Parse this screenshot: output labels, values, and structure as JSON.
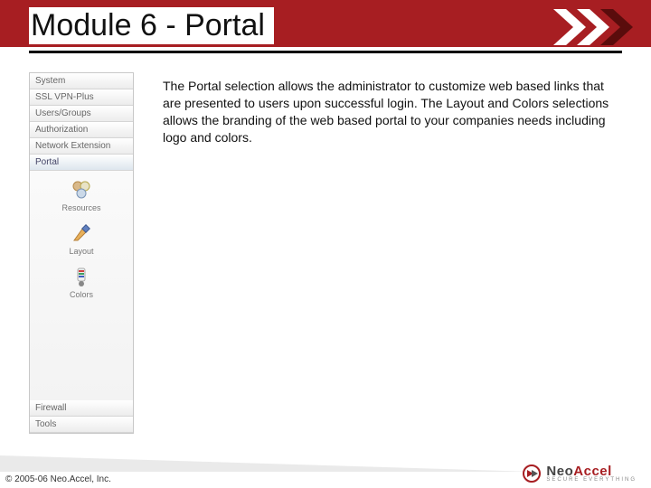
{
  "header": {
    "title": "Module 6 - Portal"
  },
  "sidebar": {
    "top_items": [
      {
        "label": "System"
      },
      {
        "label": "SSL VPN-Plus"
      },
      {
        "label": "Users/Groups"
      },
      {
        "label": "Authorization"
      },
      {
        "label": "Network Extension"
      },
      {
        "label": "Portal"
      }
    ],
    "portal_items": [
      {
        "label": "Resources"
      },
      {
        "label": "Layout"
      },
      {
        "label": "Colors"
      }
    ],
    "bottom_items": [
      {
        "label": "Firewall"
      },
      {
        "label": "Tools"
      }
    ]
  },
  "body": {
    "text": "The Portal selection allows the administrator to customize web based links that are presented to users upon successful login. The Layout and Colors selections allows the branding of the web based portal to your companies needs including logo and colors."
  },
  "footer": {
    "copyright": "© 2005-06 Neo.Accel, Inc.",
    "logo_neo": "Neo",
    "logo_accel": "Accel",
    "logo_tag": "SECURE EVERYTHING"
  }
}
